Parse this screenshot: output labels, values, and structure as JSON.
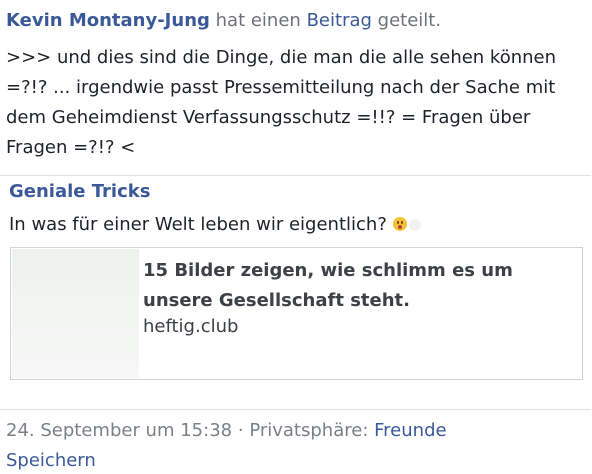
{
  "post": {
    "author": "Kevin Montany-Jung",
    "action_text": "hat einen",
    "object_link": "Beitrag",
    "action_suffix": "geteilt.",
    "text": ">>> und dies sind die Dinge, die man die alle sehen können =?!? ... irgendwie passt Pressemitteilung nach der Sache mit dem Geheimdienst Verfassungsschutz =!!? = Fragen über Fragen =?!? <"
  },
  "shared": {
    "page_name": "Geniale Tricks",
    "text": "In was für einer Welt leben wir eigentlich?",
    "emoji": "worried-face-emoji",
    "link_card": {
      "title": "15 Bilder zeigen, wie schlimm es um unsere Gesellschaft steht.",
      "domain": "heftig.club"
    }
  },
  "meta": {
    "date": "24. September um 15:38",
    "separator": "·",
    "privacy_label": "Privatsphäre:",
    "privacy_value": "Freunde",
    "save_label": "Speichern"
  },
  "colors": {
    "link": "#3b5998",
    "text": "#1d2129",
    "muted": "#7b7f87",
    "border": "#dfe1e5"
  }
}
